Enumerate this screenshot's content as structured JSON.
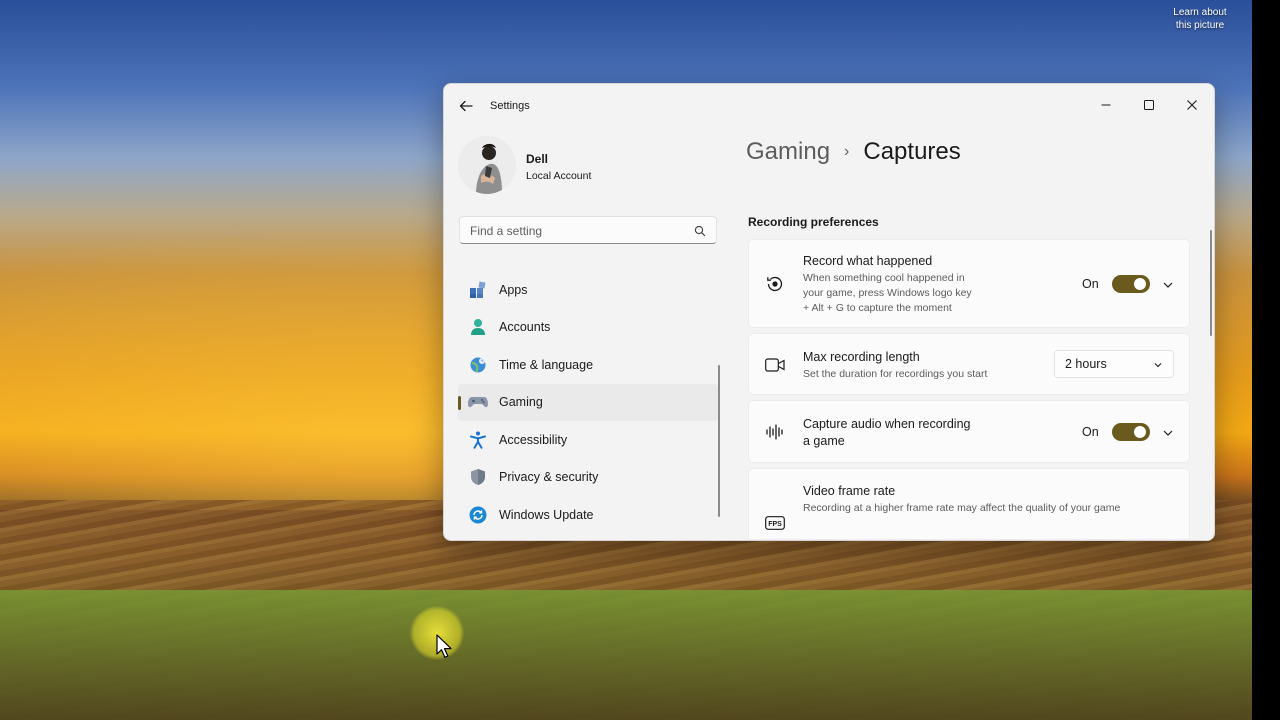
{
  "desktop": {
    "learn_about_line1": "Learn about",
    "learn_about_line2": "this picture"
  },
  "window": {
    "title": "Settings",
    "controls": {
      "minimize": "minimize-icon",
      "maximize": "maximize-icon",
      "close": "close-icon"
    }
  },
  "profile": {
    "name": "Dell",
    "account_type": "Local Account"
  },
  "search": {
    "placeholder": "Find a setting"
  },
  "sidebar": {
    "items": [
      {
        "label": "Apps",
        "icon": "apps-icon",
        "active": false
      },
      {
        "label": "Accounts",
        "icon": "accounts-icon",
        "active": false
      },
      {
        "label": "Time & language",
        "icon": "globe-clock-icon",
        "active": false
      },
      {
        "label": "Gaming",
        "icon": "gamepad-icon",
        "active": true
      },
      {
        "label": "Accessibility",
        "icon": "accessibility-icon",
        "active": false
      },
      {
        "label": "Privacy & security",
        "icon": "shield-icon",
        "active": false
      },
      {
        "label": "Windows Update",
        "icon": "update-icon",
        "active": false
      }
    ]
  },
  "breadcrumb": {
    "parent": "Gaming",
    "separator": "›",
    "current": "Captures"
  },
  "main": {
    "section_title": "Recording preferences",
    "cards": {
      "record_what_happened": {
        "title": "Record what happened",
        "desc_line1": "When something cool happened in",
        "desc_line2": "your game, press Windows logo key",
        "desc_line3": "+ Alt + G to capture the moment",
        "state": "On",
        "enabled": true
      },
      "max_recording_length": {
        "title": "Max recording length",
        "desc": "Set the duration for recordings you start",
        "value": "2 hours"
      },
      "capture_audio": {
        "title_line1": "Capture audio when recording",
        "title_line2": "a game",
        "state": "On",
        "enabled": true
      },
      "video_frame_rate": {
        "title": "Video frame rate",
        "desc": "Recording at a higher frame rate may affect the quality of your game",
        "icon_text": "FPS"
      }
    }
  },
  "colors": {
    "accent": "#6b5a1e",
    "window_bg": "#f3f3f3",
    "card_bg": "#fbfbfb"
  }
}
